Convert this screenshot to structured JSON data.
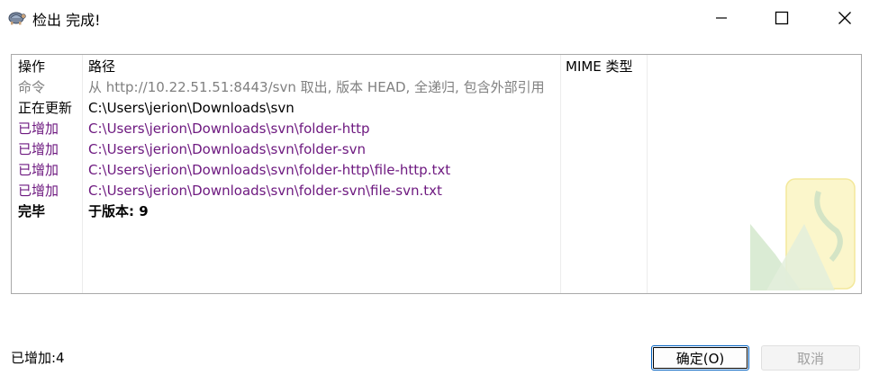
{
  "window": {
    "title": "检出 完成!",
    "app_icon": "tortoisesvn-icon"
  },
  "log": {
    "columns": [
      "操作",
      "路径",
      "MIME 类型"
    ],
    "rows": [
      {
        "action": "命令",
        "path": "从 http://10.22.51.51:8443/svn 取出, 版本 HEAD, 全递归, 包含外部引用",
        "style": "gray"
      },
      {
        "action": "正在更新",
        "path": "C:\\Users\\jerion\\Downloads\\svn",
        "style": "normal"
      },
      {
        "action": "已增加",
        "path": "C:\\Users\\jerion\\Downloads\\svn\\folder-http",
        "style": "purple"
      },
      {
        "action": "已增加",
        "path": "C:\\Users\\jerion\\Downloads\\svn\\folder-svn",
        "style": "purple"
      },
      {
        "action": "已增加",
        "path": "C:\\Users\\jerion\\Downloads\\svn\\folder-http\\file-http.txt",
        "style": "purple"
      },
      {
        "action": "已增加",
        "path": "C:\\Users\\jerion\\Downloads\\svn\\folder-svn\\file-svn.txt",
        "style": "purple"
      },
      {
        "action": "完毕",
        "path": "于版本: 9",
        "style": "bold"
      }
    ]
  },
  "status": {
    "text": "已增加:4"
  },
  "buttons": {
    "ok": "确定(O)",
    "cancel": "取消"
  },
  "colors": {
    "added_text": "#6e1a80",
    "command_text": "#808080",
    "default_button_border": "#0060c0"
  }
}
